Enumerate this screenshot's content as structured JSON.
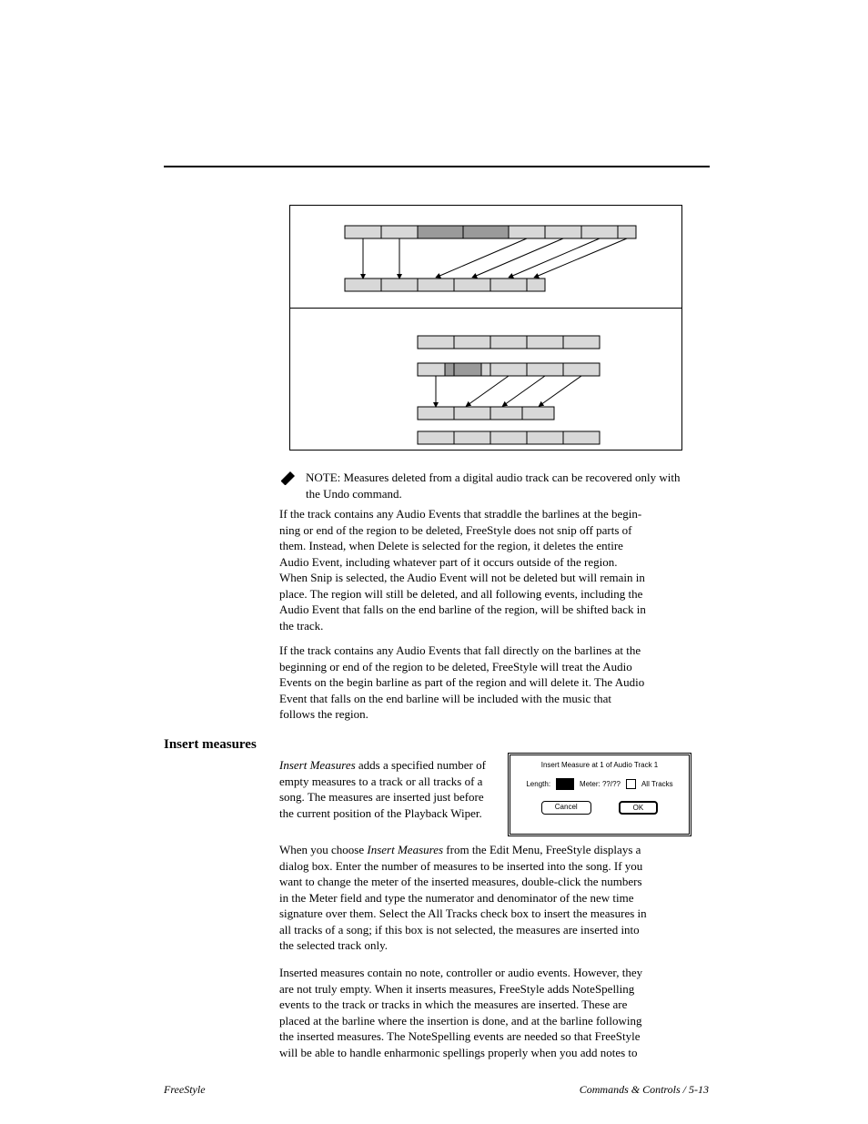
{
  "note": {
    "line1": "NOTE: Measures deleted from a digital audio track can be recovered only with",
    "line2": "the Undo command.",
    "line3": "If the track contains any Audio Events that straddle the barlines at the begin-",
    "line4": "ning or end of the region to be deleted, FreeStyle does not snip off parts of",
    "line5": "them. Instead, when Delete is selected for the region, it deletes the entire",
    "line6": "Audio Event, including whatever part of it occurs outside of the region.",
    "line7": "When Snip is selected, the Audio Event will not be deleted but will remain in",
    "line8": "place. The region will still be deleted, and all following events, including the",
    "line9": "Audio Event that falls on the end barline of the region, will be shifted back in",
    "line10": "the track.",
    "line11": "If the track contains any Audio Events that fall directly on the barlines at the",
    "line12": "beginning or end of the region to be deleted, FreeStyle will treat the Audio",
    "line13": "Events on the begin barline as part of the region and will delete it. The Audio",
    "line14": "Event that falls on the end barline will be included with the music that",
    "line15": "follows the region."
  },
  "insert": {
    "heading": "Insert measures",
    "p1a": "Insert Measures",
    "p1b": " adds a specified number of",
    "p1c": "empty measures to a track or all tracks of a",
    "p1d": "song. The measures are inserted just before",
    "p1e": "the current position of the Playback Wiper.",
    "p2a": "When you choose ",
    "p2b": "Insert Measures",
    "p2c": " from the Edit Menu, FreeStyle displays a",
    "p2d": "dialog box. Enter the number of measures to be inserted into the song. If you",
    "p2e": "want to change the meter of the inserted measures, double-click the numbers",
    "p2f": "in the Meter field and type the numerator and denominator of the new time",
    "p2g": "signature over them. Select the All Tracks check box to insert the measures in",
    "p2h": "all tracks of a song; if this box is not selected, the measures are inserted into",
    "p2i": "the selected track only.",
    "p3a": "Inserted measures contain no note, controller or audio events. However, they",
    "p3b": "are not truly empty. When it inserts measures, FreeStyle adds NoteSpelling",
    "p3c": "events to the track or tracks in which the measures are inserted. These are",
    "p3d": "placed at the barline where the insertion is done, and at the barline following",
    "p3e": "the inserted measures. The NoteSpelling events are needed so that FreeStyle",
    "p3f": "will be able to handle enharmonic spellings properly when you add notes to"
  },
  "dialog": {
    "title": "Insert Measure at 1 of Audio Track 1",
    "length": "Length:",
    "meter": "Meter: ??/??",
    "alltracks": "All Tracks",
    "cancel": "Cancel",
    "ok": "OK"
  },
  "footer": {
    "left": "FreeStyle",
    "right": "Commands & Controls / 5-13"
  }
}
